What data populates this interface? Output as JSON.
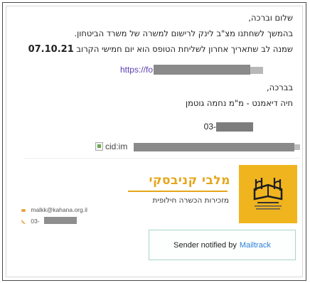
{
  "email": {
    "greeting": "שלום וברכה,",
    "line2": "בהמשך לשחתנו מצ\"ב לינק לרישום למשרה של משרד הביטחון.",
    "line3_text": "שמנה לב שתאריך אחרון לשליחת הטופס הוא יום חמישי הקרוב",
    "line3_date": "07.10.21",
    "link_prefix": "https://fo",
    "closing": "בברכה,",
    "signature_name": "חיה דיאמנט - מ\"מ נחמה גוטמן",
    "phone_prefix": "03-",
    "image_alt_prefix": "cid:im"
  },
  "signature_block": {
    "brand_name": "מלבי קניבסקי",
    "brand_tagline": "מזכירות הכשרה חילופית",
    "email_contact": "malkk@kahana.org.il",
    "phone_contact_prefix": "03-",
    "brand_color": "#f0b41e",
    "logo_icon": "book-logo-icon"
  },
  "mailtrack": {
    "text": "Sender notified by",
    "link_text": "Mailtrack",
    "link_color": "#2f7fd8"
  }
}
